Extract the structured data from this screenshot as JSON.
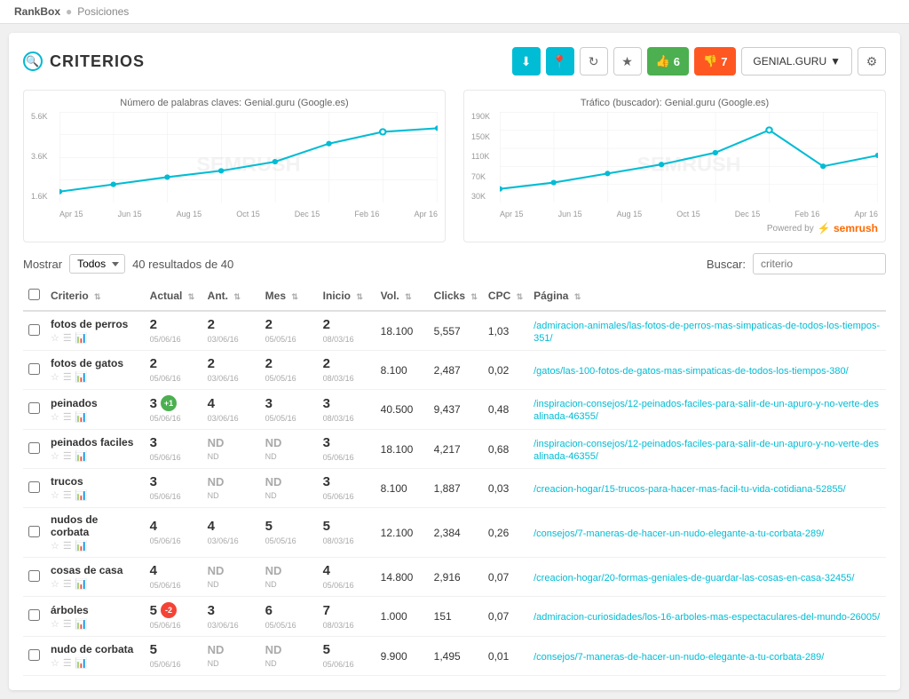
{
  "topbar": {
    "brand": "RankBox",
    "separator": "●",
    "current": "Posiciones"
  },
  "header": {
    "title": "CRITERIOS",
    "search_icon": "🔍"
  },
  "actions": {
    "download_icon": "⬇",
    "location_icon": "📍",
    "refresh_icon": "↻",
    "star_icon": "★",
    "likes_label": "6",
    "dislikes_label": "7",
    "domain": "GENIAL.GURU",
    "settings_icon": "⚙"
  },
  "chart1": {
    "title": "Número de palabras claves: Genial.guru (Google.es)",
    "y_labels": [
      "5.6K",
      "3.6K",
      "1.6K"
    ],
    "x_labels": [
      "Apr 15",
      "Jun 15",
      "Aug 15",
      "Oct 15",
      "Dec 15",
      "Feb 16",
      "Apr 16"
    ]
  },
  "chart2": {
    "title": "Tráfico (buscador): Genial.guru (Google.es)",
    "y_labels": [
      "190K",
      "150K",
      "110K",
      "70K",
      "30K"
    ],
    "x_labels": [
      "Apr 15",
      "Jun 15",
      "Aug 15",
      "Oct 15",
      "Dec 15",
      "Feb 16",
      "Apr 16"
    ]
  },
  "semrush": {
    "powered_by": "Powered by",
    "logo": "semrush"
  },
  "filter": {
    "mostrar_label": "Mostrar",
    "mostrar_value": "Todos",
    "results_text": "40 resultados de 40",
    "buscar_label": "Buscar:",
    "buscar_placeholder": "criterio"
  },
  "table": {
    "headers": [
      "",
      "Criterio",
      "Actual",
      "Ant.",
      "Mes",
      "Inicio",
      "Vol.",
      "Clicks",
      "CPC",
      "Página"
    ],
    "rows": [
      {
        "criterio": "fotos de perros",
        "actual": "2",
        "actual_date": "05/06/16",
        "ant": "2",
        "ant_date": "03/06/16",
        "mes": "2",
        "mes_date": "05/05/16",
        "inicio": "2",
        "inicio_date": "08/03/16",
        "vol": "18.100",
        "clicks": "5,557",
        "cpc": "1,03",
        "pagina": "/admiracion-animales/las-fotos-de-perros-mas-simpaticas-de-todos-los-tiempos-351/",
        "badge": null
      },
      {
        "criterio": "fotos de gatos",
        "actual": "2",
        "actual_date": "05/06/16",
        "ant": "2",
        "ant_date": "03/06/16",
        "mes": "2",
        "mes_date": "05/05/16",
        "inicio": "2",
        "inicio_date": "08/03/16",
        "vol": "8.100",
        "clicks": "2,487",
        "cpc": "0,02",
        "pagina": "/gatos/las-100-fotos-de-gatos-mas-simpaticas-de-todos-los-tiempos-380/",
        "badge": null
      },
      {
        "criterio": "peinados",
        "actual": "3",
        "actual_date": "05/06/16",
        "ant": "4",
        "ant_date": "03/06/16",
        "mes": "3",
        "mes_date": "05/05/16",
        "inicio": "3",
        "inicio_date": "08/03/16",
        "vol": "40.500",
        "clicks": "9,437",
        "cpc": "0,48",
        "pagina": "/inspiracion-consejos/12-peinados-faciles-para-salir-de-un-apuro-y-no-verte-desalinada-46355/",
        "badge": "+1",
        "badge_type": "positive"
      },
      {
        "criterio": "peinados faciles",
        "actual": "3",
        "actual_date": "05/06/16",
        "ant": "ND",
        "ant_date": "ND",
        "mes": "ND",
        "mes_date": "ND",
        "inicio": "3",
        "inicio_date": "05/06/16",
        "vol": "18.100",
        "clicks": "4,217",
        "cpc": "0,68",
        "pagina": "/inspiracion-consejos/12-peinados-faciles-para-salir-de-un-apuro-y-no-verte-desalinada-46355/",
        "badge": null
      },
      {
        "criterio": "trucos",
        "actual": "3",
        "actual_date": "05/06/16",
        "ant": "ND",
        "ant_date": "ND",
        "mes": "ND",
        "mes_date": "ND",
        "inicio": "3",
        "inicio_date": "05/06/16",
        "vol": "8.100",
        "clicks": "1,887",
        "cpc": "0,03",
        "pagina": "/creacion-hogar/15-trucos-para-hacer-mas-facil-tu-vida-cotidiana-52855/",
        "badge": null
      },
      {
        "criterio": "nudos de corbata",
        "actual": "4",
        "actual_date": "05/06/16",
        "ant": "4",
        "ant_date": "03/06/16",
        "mes": "5",
        "mes_date": "05/05/16",
        "inicio": "5",
        "inicio_date": "08/03/16",
        "vol": "12.100",
        "clicks": "2,384",
        "cpc": "0,26",
        "pagina": "/consejos/7-maneras-de-hacer-un-nudo-elegante-a-tu-corbata-289/",
        "badge": null
      },
      {
        "criterio": "cosas de casa",
        "actual": "4",
        "actual_date": "05/06/16",
        "ant": "ND",
        "ant_date": "ND",
        "mes": "ND",
        "mes_date": "ND",
        "inicio": "4",
        "inicio_date": "05/06/16",
        "vol": "14.800",
        "clicks": "2,916",
        "cpc": "0,07",
        "pagina": "/creacion-hogar/20-formas-geniales-de-guardar-las-cosas-en-casa-32455/",
        "badge": null
      },
      {
        "criterio": "árboles",
        "actual": "5",
        "actual_date": "05/06/16",
        "ant": "3",
        "ant_date": "03/06/16",
        "mes": "6",
        "mes_date": "05/05/16",
        "inicio": "7",
        "inicio_date": "08/03/16",
        "vol": "1.000",
        "clicks": "151",
        "cpc": "0,07",
        "pagina": "/admiracion-curiosidades/los-16-arboles-mas-espectaculares-del-mundo-26005/",
        "badge": "-2",
        "badge_type": "negative"
      },
      {
        "criterio": "nudo de corbata",
        "actual": "5",
        "actual_date": "05/06/16",
        "ant": "ND",
        "ant_date": "ND",
        "mes": "ND",
        "mes_date": "ND",
        "inicio": "5",
        "inicio_date": "05/06/16",
        "vol": "9.900",
        "clicks": "1,495",
        "cpc": "0,01",
        "pagina": "/consejos/7-maneras-de-hacer-un-nudo-elegante-a-tu-corbata-289/",
        "badge": null
      }
    ]
  }
}
